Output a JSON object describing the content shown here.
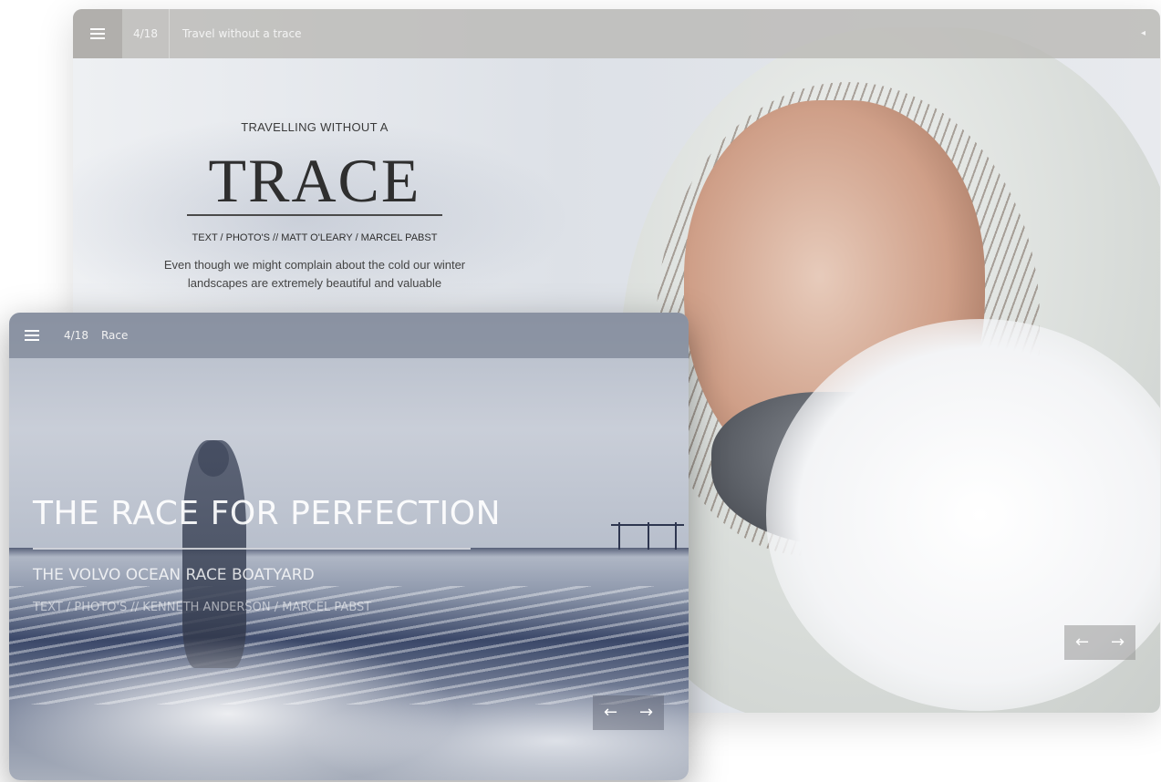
{
  "back_window": {
    "counter": "4/18",
    "title": "Travel without a trace",
    "sound_icon": "◂",
    "article": {
      "kicker": "TRAVELLING WITHOUT A",
      "headline": "TRACE",
      "byline": "TEXT / PHOTO'S  //  MATT O'LEARY /  MARCEL PABST",
      "body": "Even though we might complain about the cold our winter landscapes are extremely beautiful and valuable"
    },
    "prev_arrow": "←",
    "next_arrow": "→"
  },
  "front_window": {
    "counter": "4/18",
    "title": "Race",
    "headline": "THE RACE FOR PERFECTION",
    "subtitle": "THE VOLVO OCEAN RACE BOATYARD",
    "byline": "TEXT / PHOTO'S // KENNETH ANDERSON / MARCEL PABST",
    "prev_arrow": "←",
    "next_arrow": "→"
  }
}
